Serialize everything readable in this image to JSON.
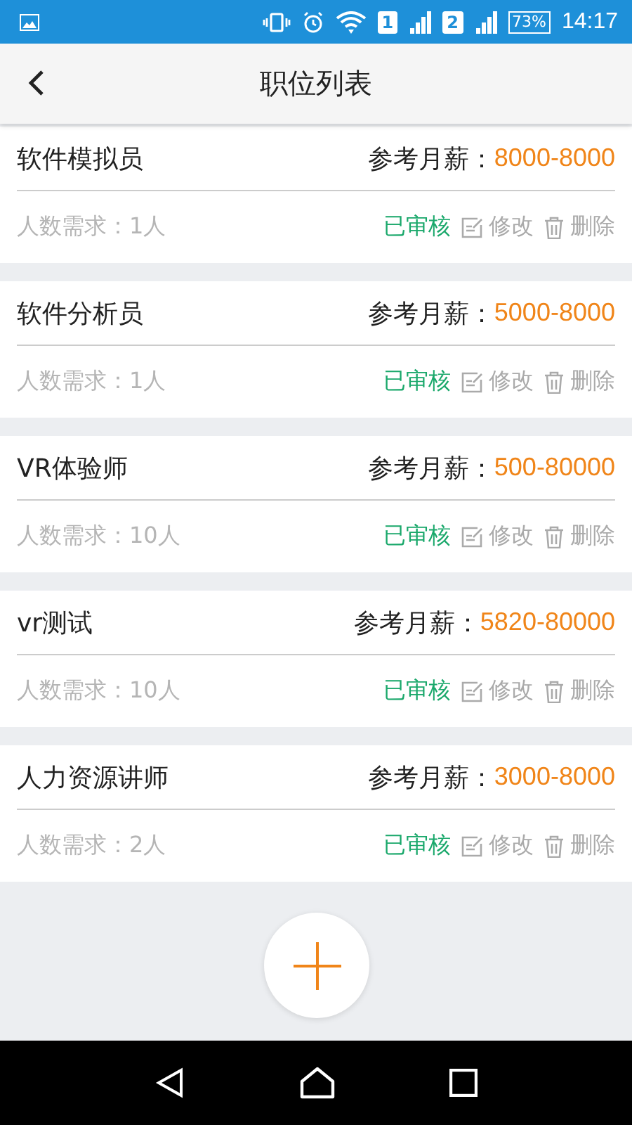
{
  "status_bar": {
    "sim_1": "1",
    "sim_2": "2",
    "battery": "73%",
    "time": "14:17"
  },
  "header": {
    "title": "职位列表"
  },
  "jobs": [
    {
      "title": "软件模拟员",
      "salary_label": "参考月薪：",
      "salary": "8000-8000",
      "headcount": "人数需求：1人",
      "status": "已审核",
      "edit": "修改",
      "delete": "删除"
    },
    {
      "title": "软件分析员",
      "salary_label": "参考月薪：",
      "salary": "5000-8000",
      "headcount": "人数需求：1人",
      "status": "已审核",
      "edit": "修改",
      "delete": "删除"
    },
    {
      "title": "VR体验师",
      "salary_label": "参考月薪：",
      "salary": "500-80000",
      "headcount": "人数需求：10人",
      "status": "已审核",
      "edit": "修改",
      "delete": "删除"
    },
    {
      "title": "vr测试",
      "salary_label": "参考月薪：",
      "salary": "5820-80000",
      "headcount": "人数需求：10人",
      "status": "已审核",
      "edit": "修改",
      "delete": "删除"
    },
    {
      "title": "人力资源讲师",
      "salary_label": "参考月薪：",
      "salary": "3000-8000",
      "headcount": "人数需求：2人",
      "status": "已审核",
      "edit": "修改",
      "delete": "删除"
    }
  ]
}
